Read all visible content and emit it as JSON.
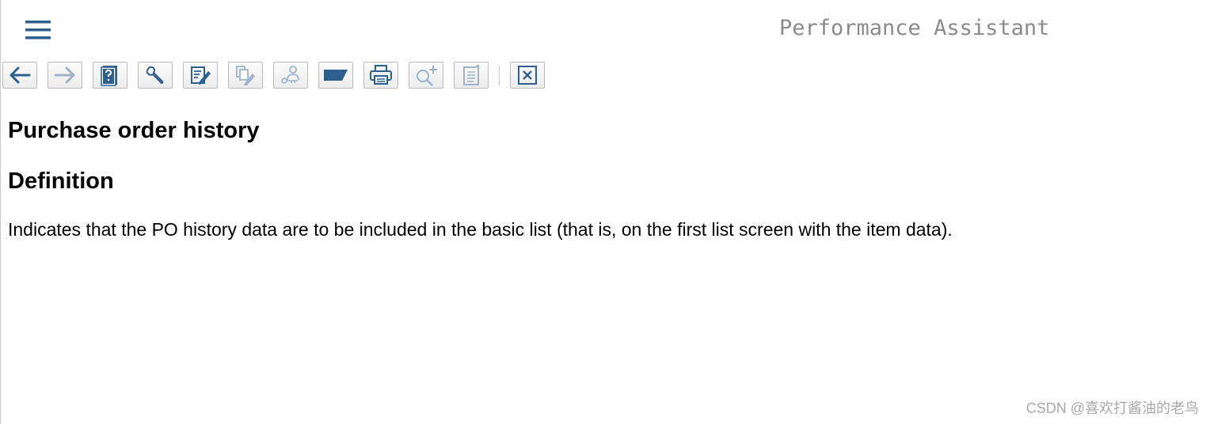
{
  "header": {
    "title": "Performance Assistant",
    "menu_icon": "hamburger-menu-icon"
  },
  "toolbar": {
    "buttons": [
      {
        "icon": "arrow-left-icon",
        "enabled": true
      },
      {
        "icon": "arrow-right-icon",
        "enabled": false
      },
      {
        "icon": "help-book-icon",
        "enabled": true
      },
      {
        "icon": "wrench-icon",
        "enabled": true
      },
      {
        "icon": "edit-document-icon",
        "enabled": true
      },
      {
        "icon": "copy-edit-icon",
        "enabled": false
      },
      {
        "icon": "user-key-icon",
        "enabled": false
      },
      {
        "icon": "flag-icon",
        "enabled": true
      },
      {
        "icon": "printer-icon",
        "enabled": true
      },
      {
        "icon": "search-plus-icon",
        "enabled": false
      },
      {
        "icon": "notes-icon",
        "enabled": false
      },
      {
        "icon": "close-icon",
        "enabled": true
      }
    ],
    "accent_color": "#2c5f8d",
    "disabled_color": "#9db3c8"
  },
  "content": {
    "title": "Purchase order history",
    "section_heading": "Definition",
    "definition_text": "Indicates that the PO history data are to be included in the basic list (that is, on the first list screen with the item data)."
  },
  "watermark": "CSDN @喜欢打酱油的老鸟"
}
